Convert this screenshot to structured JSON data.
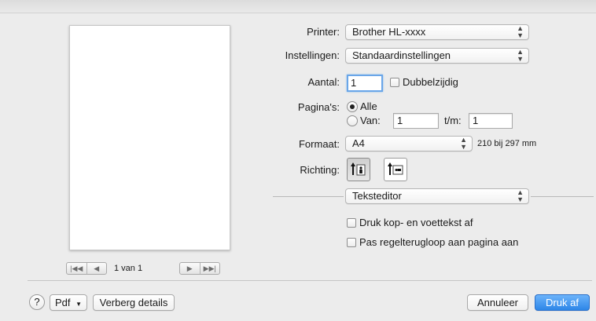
{
  "preview": {
    "page_indicator": "1 van 1",
    "nav_prev_glyphs": [
      "|◀◀",
      "◀"
    ],
    "nav_next_glyphs": [
      "▶",
      "▶▶|"
    ]
  },
  "form": {
    "printer_label": "Printer:",
    "printer_value": "Brother HL-xxxx",
    "settings_label": "Instellingen:",
    "settings_value": "Standaardinstellingen",
    "copies_label": "Aantal:",
    "copies_value": "1",
    "duplex_label": "Dubbelzijdig",
    "pages_label": "Pagina's:",
    "pages_all_label": "Alle",
    "pages_from_label": "Van:",
    "pages_from_value": "1",
    "pages_to_label": "t/m:",
    "pages_to_value": "1",
    "format_label": "Formaat:",
    "format_value": "A4",
    "format_size": "210 bij 297 mm",
    "orientation_label": "Richting:",
    "section_value": "Teksteditor",
    "header_footer_label": "Druk kop- en voettekst af",
    "rewrap_label": "Pas regelterugloop aan pagina aan"
  },
  "footer": {
    "help_label": "?",
    "pdf_label": "Pdf",
    "hide_details_label": "Verberg details",
    "cancel_label": "Annuleer",
    "print_label": "Druk af"
  },
  "icons": {
    "popup_arrows": "chevron-up-down-icon",
    "pdf_arrow": "chevron-down-icon",
    "orientation_portrait": "portrait-orientation-icon",
    "orientation_landscape": "landscape-orientation-icon"
  },
  "colors": {
    "default_button": "#2d86e8",
    "focus_ring": "#6aa6e8"
  }
}
